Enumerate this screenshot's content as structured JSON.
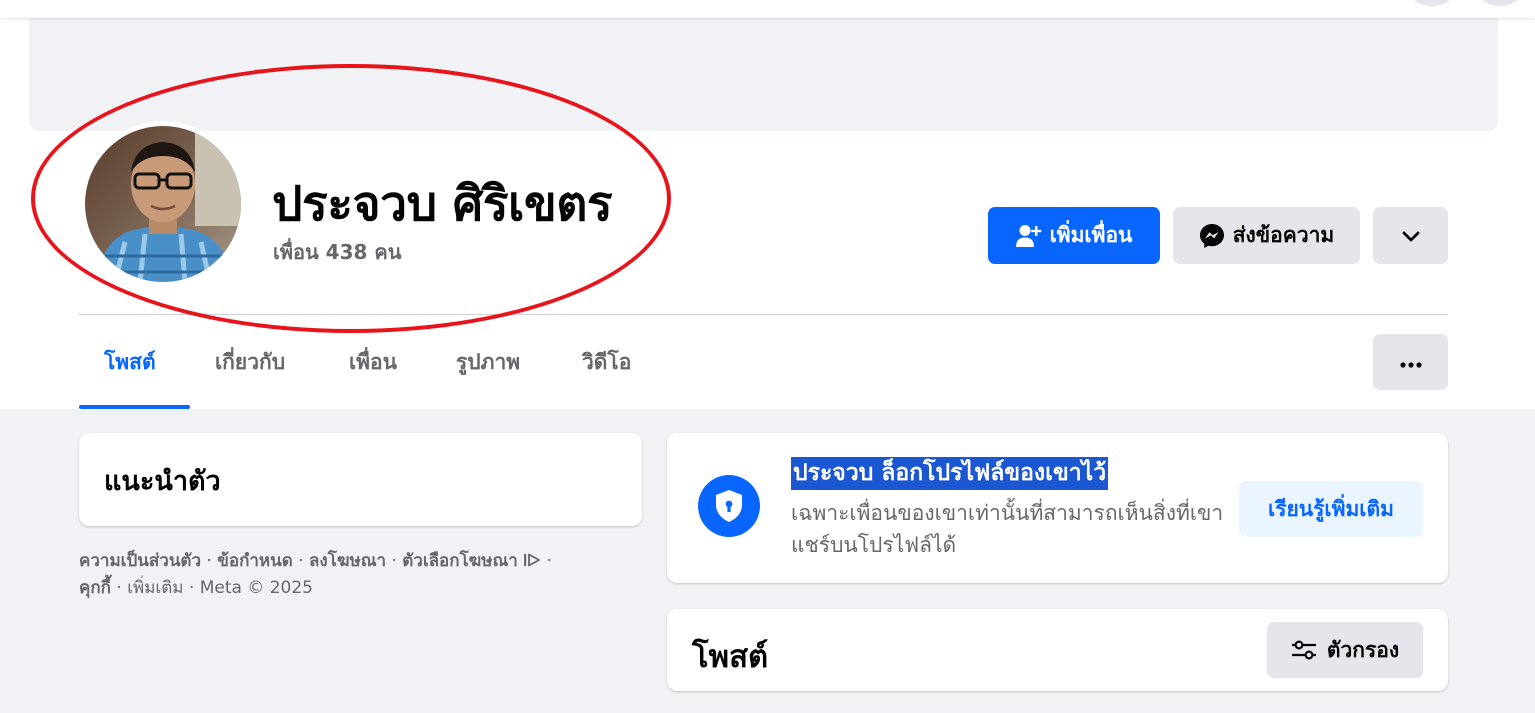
{
  "profile": {
    "name": "ประจวบ ศิริเขตร",
    "friends": "เพื่อน 438 คน"
  },
  "actions": {
    "add_friend": "เพิ่มเพื่อน",
    "message": "ส่งข้อความ"
  },
  "tabs": [
    {
      "label": "โพสต์",
      "active": true
    },
    {
      "label": "เกี่ยวกับ",
      "active": false
    },
    {
      "label": "เพื่อน",
      "active": false
    },
    {
      "label": "รูปภาพ",
      "active": false
    },
    {
      "label": "วิดีโอ",
      "active": false
    }
  ],
  "intro": {
    "title": "แนะนำตัว"
  },
  "footer": {
    "links": [
      "ความเป็นส่วนตัว",
      "ข้อกำหนด",
      "ลงโฆษณา",
      "ตัวเลือกโฆษณา",
      "คุกกี้",
      "เพิ่มเติม"
    ],
    "copyright": "Meta © 2025"
  },
  "locked": {
    "title": "ประจวบ ล็อกโปรไฟล์ของเขาไว้",
    "description": "เฉพาะเพื่อนของเขาเท่านั้นที่สามารถเห็นสิ่งที่เขาแชร์บนโปรไฟล์ได้",
    "learn_more": "เรียนรู้เพิ่มเติม"
  },
  "posts": {
    "title": "โพสต์",
    "filter": "ตัวกรอง"
  },
  "colors": {
    "primary": "#0866ff",
    "annotation": "#e8141b",
    "highlight": "#1a57d1"
  }
}
